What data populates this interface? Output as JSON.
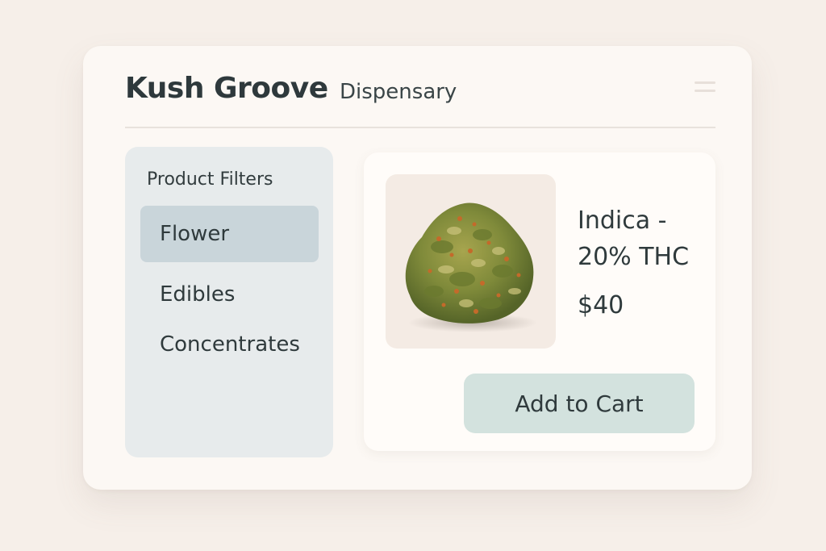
{
  "header": {
    "brand": "Kush Groove",
    "subtitle": "Dispensary",
    "menu_icon": "hamburger-menu-icon"
  },
  "sidebar": {
    "title": "Product Filters",
    "items": [
      {
        "label": "Flower",
        "active": true
      },
      {
        "label": "Edibles",
        "active": false
      },
      {
        "label": "Concentrates",
        "active": false
      }
    ]
  },
  "product": {
    "name": "Indica - 20% THC",
    "price": "$40",
    "image": "cannabis-flower-bud",
    "add_to_cart_label": "Add to Cart"
  },
  "colors": {
    "page_background": "#f6efe9",
    "window_background": "#fcf8f4",
    "sidebar_background": "#e7ebec",
    "active_filter": "#c9d5da",
    "button_background": "#d3e2de",
    "text": "#2f3a3c"
  }
}
